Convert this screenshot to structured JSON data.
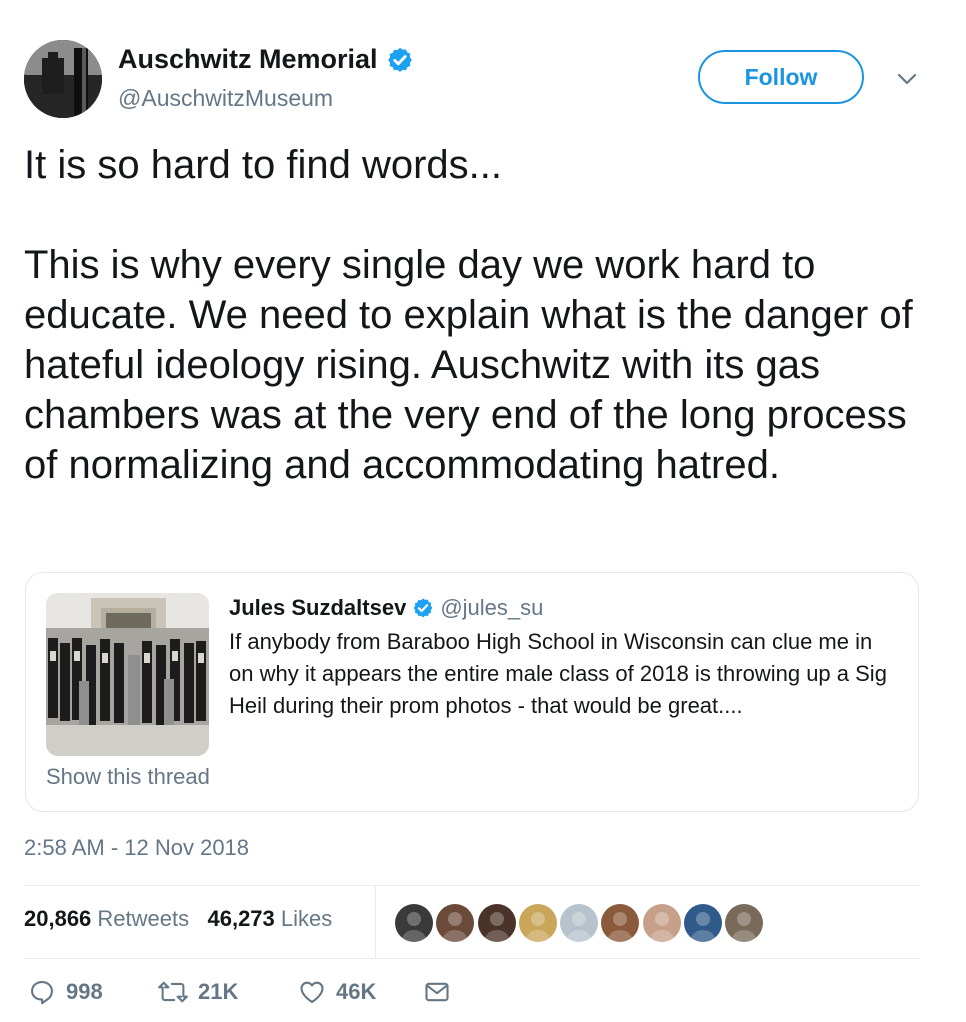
{
  "author": {
    "name": "Auschwitz Memorial",
    "handle": "@AuschwitzMuseum",
    "verified": true
  },
  "follow_label": "Follow",
  "tweet_paragraphs": [
    "It is so hard to find words...",
    "This is why every single day we work hard to educate. We need to explain what is the danger of hateful ideology rising. Auschwitz with its gas chambers was at the very end of the long process of normalizing and accommodating hatred."
  ],
  "quoted": {
    "name": "Jules Suzdaltsev",
    "handle": "@jules_su",
    "verified": true,
    "text": "If anybody from Baraboo High School in Wisconsin can clue me in on why it appears the entire male class of 2018 is throwing up a Sig Heil during their prom photos - that would be great....",
    "show_thread": "Show this thread"
  },
  "timestamp": "2:58 AM - 12 Nov 2018",
  "stats": {
    "retweets_count": "20,866",
    "retweets_label": "Retweets",
    "likes_count": "46,273",
    "likes_label": "Likes"
  },
  "liker_avatar_colors": [
    "#3a3a3a",
    "#6b4a3a",
    "#4a3328",
    "#c9a65a",
    "#b8c2cc",
    "#8a5a3a",
    "#c7a08a",
    "#2f5a8a",
    "#7a6a5a"
  ],
  "actions": {
    "replies": "998",
    "retweets": "21K",
    "likes": "46K"
  },
  "colors": {
    "accent": "#1b95e0",
    "verified": "#1da1f2",
    "secondary_text": "#657786",
    "primary_text": "#14171a"
  }
}
